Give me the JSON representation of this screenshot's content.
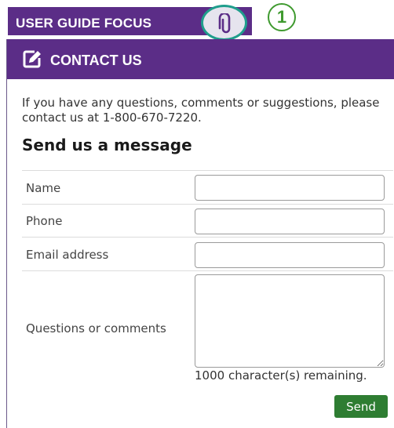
{
  "guide": {
    "title": "USER GUIDE FOCUS",
    "step_number": "1"
  },
  "icons": {
    "attachment": "paperclip-icon",
    "edit": "edit-square-icon",
    "resize": "resize-grip-icon"
  },
  "colors": {
    "brand": "#5b2d87",
    "highlight_ring": "#1f9e8c",
    "step_badge": "#3f9a2f",
    "send_button": "#2e7d32"
  },
  "contact": {
    "header_title": "CONTACT US",
    "intro": "If you have any questions, comments or suggestions, please contact us at 1-800-670-7220.",
    "heading": "Send us a message",
    "fields": [
      {
        "label": "Name",
        "value": "",
        "placeholder": ""
      },
      {
        "label": "Phone",
        "value": "",
        "placeholder": ""
      },
      {
        "label": "Email address",
        "value": "",
        "placeholder": ""
      },
      {
        "label": "Questions or comments",
        "value": "",
        "placeholder": ""
      }
    ],
    "remaining_text": "1000 character(s) remaining.",
    "send_label": "Send"
  }
}
